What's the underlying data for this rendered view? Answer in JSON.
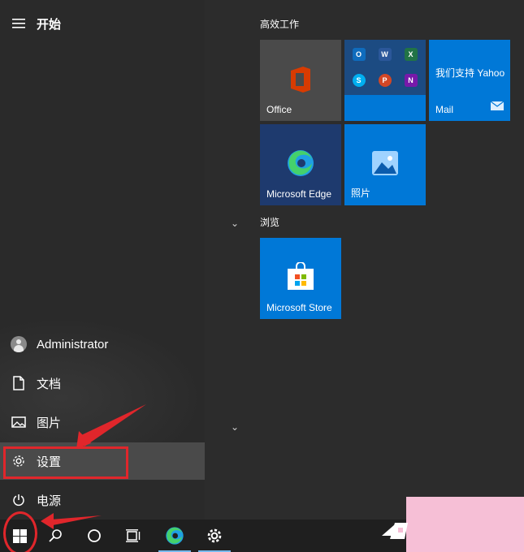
{
  "start_menu": {
    "header_label": "开始",
    "account_name": "Administrator",
    "items": [
      {
        "label": "文档",
        "icon": "document-icon"
      },
      {
        "label": "图片",
        "icon": "pictures-icon"
      },
      {
        "label": "设置",
        "icon": "gear-icon"
      },
      {
        "label": "电源",
        "icon": "power-icon"
      }
    ]
  },
  "tile_groups": [
    {
      "title": "高效工作"
    },
    {
      "title": "浏览"
    }
  ],
  "tiles": {
    "office": "Office",
    "mail_title": "我们支持 Yahoo",
    "mail": "Mail",
    "edge": "Microsoft Edge",
    "photos": "照片",
    "store": "Microsoft Store"
  },
  "office_folder_apps": [
    {
      "letter": "O",
      "color": "#0f6cbd"
    },
    {
      "letter": "W",
      "color": "#2b579a"
    },
    {
      "letter": "X",
      "color": "#217346"
    },
    {
      "letter": "S",
      "color": "#00aff0"
    },
    {
      "letter": "P",
      "color": "#d24726"
    },
    {
      "letter": "N",
      "color": "#7719aa"
    }
  ],
  "colors": {
    "accent": "#0078d7",
    "annotation": "#e0262b"
  }
}
